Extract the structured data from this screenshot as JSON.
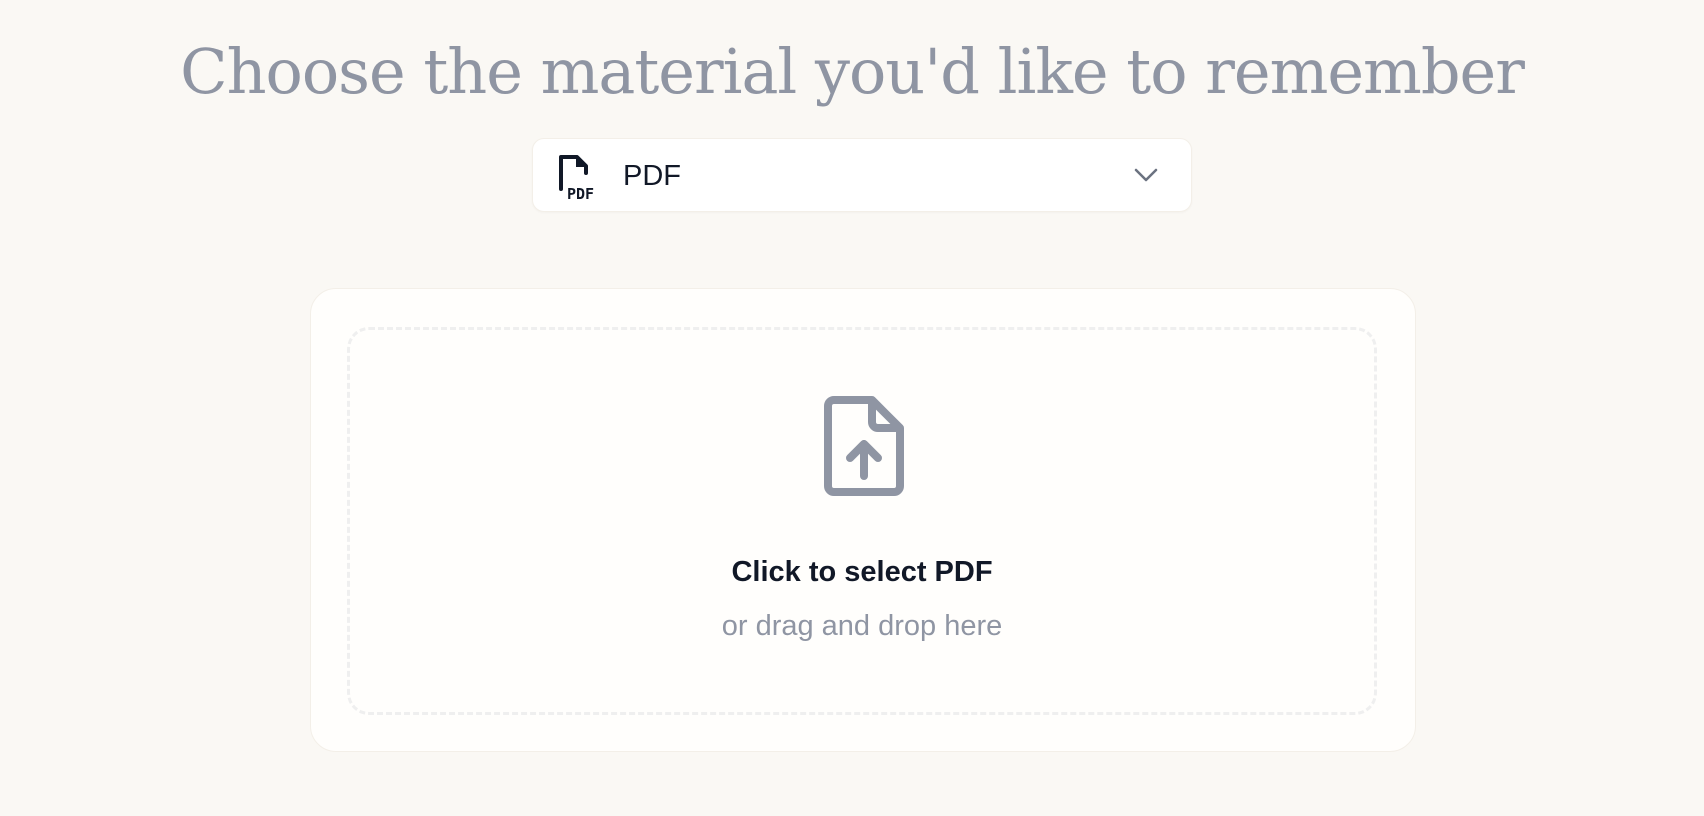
{
  "header": {
    "title": "Choose the material you'd like to remember"
  },
  "material_select": {
    "selected": "PDF",
    "icon": "pdf-file-icon",
    "chevron_icon": "chevron-down-icon"
  },
  "upload": {
    "icon": "file-upload-icon",
    "primary_text": "Click to select PDF",
    "secondary_text": "or drag and drop here"
  },
  "colors": {
    "background": "#faf8f4",
    "title": "#8f95a3",
    "text_dark": "#111827",
    "text_muted": "#8f95a3",
    "icon_muted": "#8f95a3"
  }
}
